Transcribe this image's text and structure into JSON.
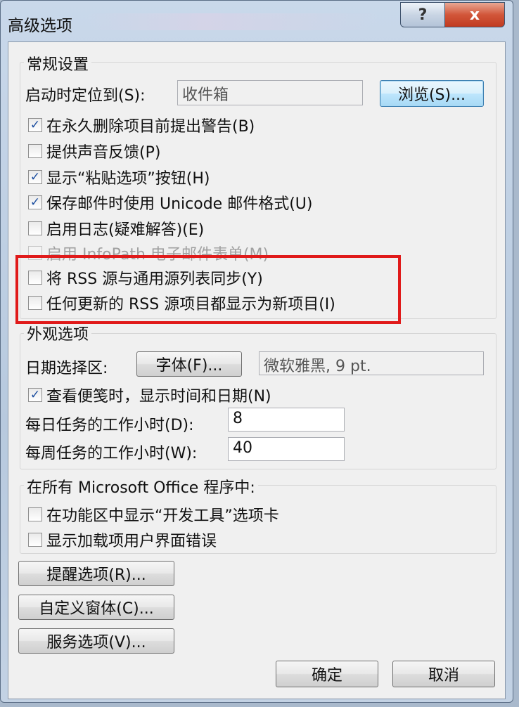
{
  "window": {
    "title": "高级选项",
    "help_label": "?",
    "close_label": "x"
  },
  "general": {
    "legend": "常规设置",
    "startup_label": "启动时定位到(S):",
    "startup_value": "收件箱",
    "browse_label": "浏览(S)...",
    "options": [
      {
        "label": "在永久删除项目前提出警告(B)",
        "checked": true
      },
      {
        "label": "提供声音反馈(P)",
        "checked": false
      },
      {
        "label": "显示“粘贴选项”按钮(H)",
        "checked": true
      },
      {
        "label": "保存邮件时使用 Unicode 邮件格式(U)",
        "checked": true
      },
      {
        "label": "启用日志(疑难解答)(E)",
        "checked": false
      },
      {
        "label": "启用 InfoPath 电子邮件表单(M)",
        "checked": false,
        "disabled": true
      },
      {
        "label": "将 RSS 源与通用源列表同步(Y)",
        "checked": false
      },
      {
        "label": "任何更新的 RSS 源项目都显示为新项目(I)",
        "checked": false
      }
    ]
  },
  "appearance": {
    "legend": "外观选项",
    "date_picker_label": "日期选择区:",
    "font_button": "字体(F)...",
    "font_value": "微软雅黑, 9 pt.",
    "show_time_label": "查看便笺时，显示时间和日期(N)",
    "show_time_checked": true,
    "daily_label": "每日任务的工作小时(D):",
    "daily_value": "8",
    "weekly_label": "每周任务的工作小时(W):",
    "weekly_value": "40"
  },
  "office": {
    "legend": "在所有 Microsoft Office 程序中:",
    "options": [
      {
        "label": "在功能区中显示“开发工具”选项卡",
        "checked": false
      },
      {
        "label": "显示加载项用户界面错误",
        "checked": false
      }
    ]
  },
  "buttons": {
    "reminder": "提醒选项(R)...",
    "custom_form": "自定义窗体(C)...",
    "service": "服务选项(V)...",
    "ok": "确定",
    "cancel": "取消"
  },
  "check_mark": "✓"
}
